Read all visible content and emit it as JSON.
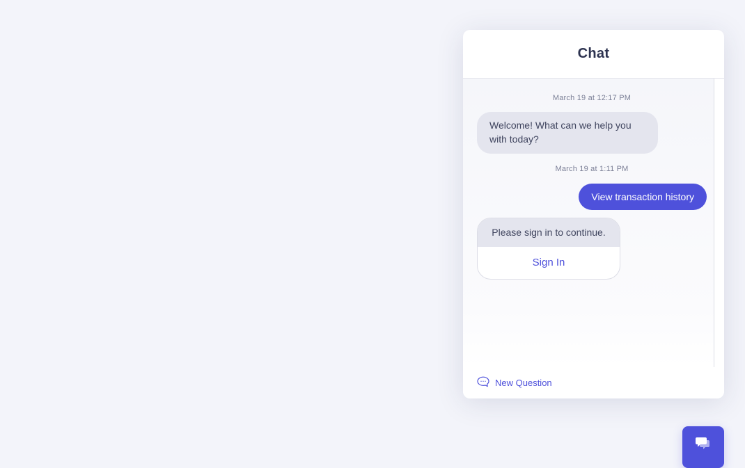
{
  "chat": {
    "title": "Chat",
    "messages": [
      {
        "timestamp": "March 19 at 12:17 PM",
        "sender": "agent",
        "text": "Welcome! What can we help you with today?"
      },
      {
        "timestamp": "March 19 at 1:11 PM",
        "sender": "user",
        "text": "View transaction history"
      },
      {
        "sender": "agent",
        "text": "Please sign in to continue.",
        "action_label": "Sign In"
      }
    ],
    "footer": {
      "new_question_label": "New Question",
      "icon": "chat-bubble-icon"
    }
  },
  "launcher": {
    "icon": "chat-bubbles-icon"
  },
  "colors": {
    "accent": "#4e51db",
    "incoming_bubble": "#e4e5ee",
    "background": "#f3f4fa",
    "title_text": "#2d3350"
  }
}
